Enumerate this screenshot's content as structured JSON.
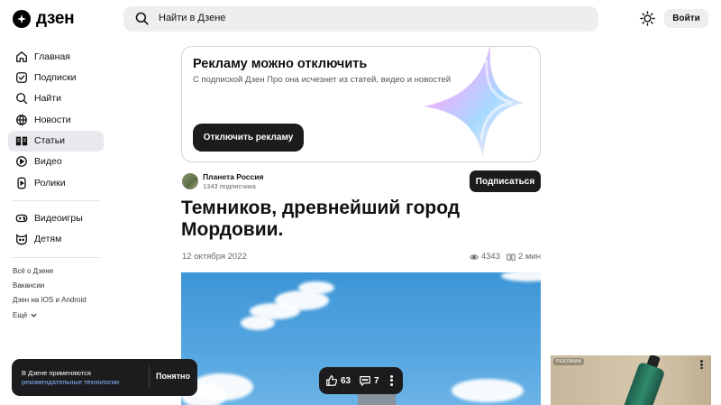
{
  "header": {
    "logo_text": "дзен",
    "search_placeholder": "Найти в Дзене",
    "login_label": "Войти"
  },
  "sidebar": {
    "items": [
      {
        "label": "Главная",
        "icon": "home-icon"
      },
      {
        "label": "Подписки",
        "icon": "subscriptions-icon"
      },
      {
        "label": "Найти",
        "icon": "search-icon"
      },
      {
        "label": "Новости",
        "icon": "news-icon"
      },
      {
        "label": "Статьи",
        "icon": "articles-icon",
        "active": true
      },
      {
        "label": "Видео",
        "icon": "video-icon"
      },
      {
        "label": "Ролики",
        "icon": "shorts-icon"
      }
    ],
    "items2": [
      {
        "label": "Видеоигры",
        "icon": "gamepad-icon"
      },
      {
        "label": "Детям",
        "icon": "kids-icon"
      }
    ],
    "footer_links": [
      "Всё о Дзене",
      "Вакансии",
      "Дзен на IOS и Android",
      "Ещё"
    ]
  },
  "ad_card": {
    "title": "Рекламу можно отключить",
    "subtitle": "С подпиской Дзен Про она исчезнет из статей, видео и новостей",
    "button_label": "Отключить рекламу"
  },
  "article": {
    "channel_name": "Планета Россия",
    "channel_subscribers": "1343 подписчика",
    "subscribe_label": "Подписаться",
    "title": "Темников, древнейший город Мордовии.",
    "date": "12 октября 2022",
    "views": "4343",
    "read_time": "2 мин"
  },
  "reactions": {
    "likes": "63",
    "comments": "7"
  },
  "cookie_toast": {
    "line1": "В Дзене применяются",
    "line2": "рекомендательные технологии",
    "button_label": "Понятно"
  },
  "side_ad": {
    "badge": "РЕКЛАМА"
  },
  "colors": {
    "dark": "#1c1c1f",
    "surface": "#eeeef1",
    "link": "#8ab4ff"
  }
}
